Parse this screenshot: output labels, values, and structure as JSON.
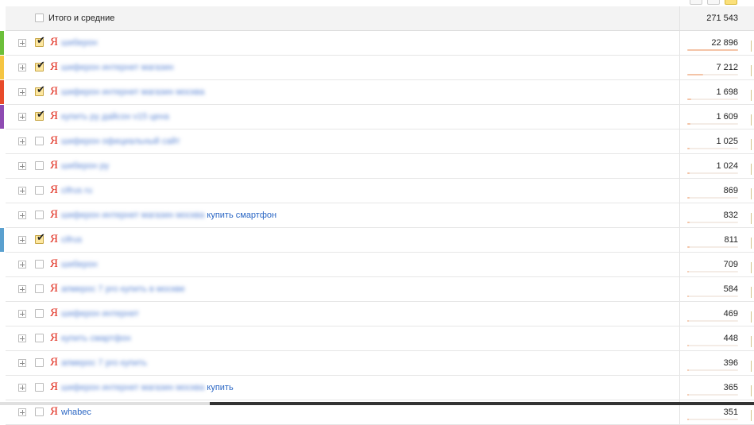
{
  "totals": {
    "label": "Итого и средние",
    "value": "271 543"
  },
  "rows": [
    {
      "phrase_blur": "шиберон",
      "phrase_clear": "",
      "value": "22 896",
      "checked": true,
      "stripe": "#6cbf3a",
      "share": 1.0
    },
    {
      "phrase_blur": "шиферон интернет магазин",
      "phrase_clear": "",
      "value": "7 212",
      "checked": true,
      "stripe": "#f5c542",
      "share": 0.32
    },
    {
      "phrase_blur": "шиферон интернет магазин москва",
      "phrase_clear": "",
      "value": "1 698",
      "checked": true,
      "stripe": "#e84a2a",
      "share": 0.08
    },
    {
      "phrase_blur": "купить ру дайсон v15 цена",
      "phrase_clear": "",
      "value": "1 609",
      "checked": true,
      "stripe": "#8e4bb2",
      "share": 0.07
    },
    {
      "phrase_blur": "шиферон официальный сайт",
      "phrase_clear": "",
      "value": "1 025",
      "checked": false,
      "stripe": "",
      "share": 0.05
    },
    {
      "phrase_blur": "шиберон ру",
      "phrase_clear": "",
      "value": "1 024",
      "checked": false,
      "stripe": "",
      "share": 0.05
    },
    {
      "phrase_blur": "cifrus ru",
      "phrase_clear": "",
      "value": "869",
      "checked": false,
      "stripe": "",
      "share": 0.04
    },
    {
      "phrase_blur": "шиферон интернет магазин москва",
      "phrase_clear": "купить смартфон",
      "value": "832",
      "checked": false,
      "stripe": "",
      "share": 0.04
    },
    {
      "phrase_blur": "cifrus",
      "phrase_clear": "",
      "value": "811",
      "checked": true,
      "stripe": "#5aa0cf",
      "share": 0.04
    },
    {
      "phrase_blur": "шиберон",
      "phrase_clear": "",
      "value": "709",
      "checked": false,
      "stripe": "",
      "share": 0.03
    },
    {
      "phrase_blur": "апмерос 7 pro купить в москве",
      "phrase_clear": "",
      "value": "584",
      "checked": false,
      "stripe": "",
      "share": 0.03
    },
    {
      "phrase_blur": "шиферон интернет",
      "phrase_clear": "",
      "value": "469",
      "checked": false,
      "stripe": "",
      "share": 0.02
    },
    {
      "phrase_blur": "купить смартфон",
      "phrase_clear": "",
      "value": "448",
      "checked": false,
      "stripe": "",
      "share": 0.02
    },
    {
      "phrase_blur": "апмерос 7 pro купить",
      "phrase_clear": "",
      "value": "396",
      "checked": false,
      "stripe": "",
      "share": 0.02
    },
    {
      "phrase_blur": "шиферон интернет магазин москва",
      "phrase_clear": "купить",
      "value": "365",
      "checked": false,
      "stripe": "",
      "share": 0.02
    },
    {
      "phrase_blur": "",
      "phrase_clear": "whabec",
      "value": "351",
      "checked": false,
      "stripe": "",
      "share": 0.02
    }
  ],
  "icons": {
    "expand": "plus-square-icon",
    "engine": "yandex-logo-icon",
    "check": "check-icon"
  },
  "colors": {
    "accent_link": "#2a66c4",
    "checkbox_checked": "#fde7a0",
    "bar": "#f4c4a7"
  }
}
